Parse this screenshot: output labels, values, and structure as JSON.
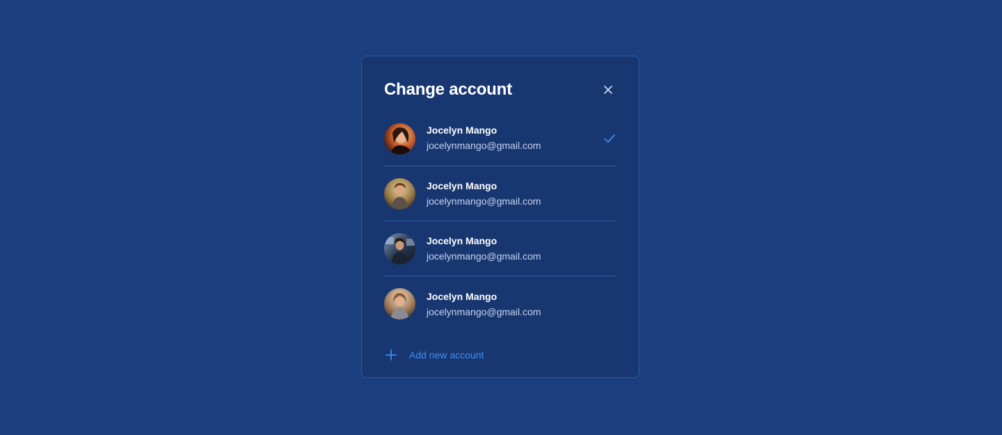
{
  "dialog": {
    "title": "Change account",
    "close_icon": "close-icon",
    "accounts": [
      {
        "name": "Jocelyn Mango",
        "email": "jocelynmango@gmail.com",
        "selected": true
      },
      {
        "name": "Jocelyn Mango",
        "email": "jocelynmango@gmail.com",
        "selected": false
      },
      {
        "name": "Jocelyn Mango",
        "email": "jocelynmango@gmail.com",
        "selected": false
      },
      {
        "name": "Jocelyn Mango",
        "email": "jocelynmango@gmail.com",
        "selected": false
      }
    ],
    "add_account_label": "Add new account",
    "add_icon": "plus-icon",
    "selected_icon": "check-icon"
  },
  "colors": {
    "background": "#1b3f7e",
    "panel": "#183771",
    "accent": "#3d8df0",
    "divider": "#2e5fa9"
  }
}
